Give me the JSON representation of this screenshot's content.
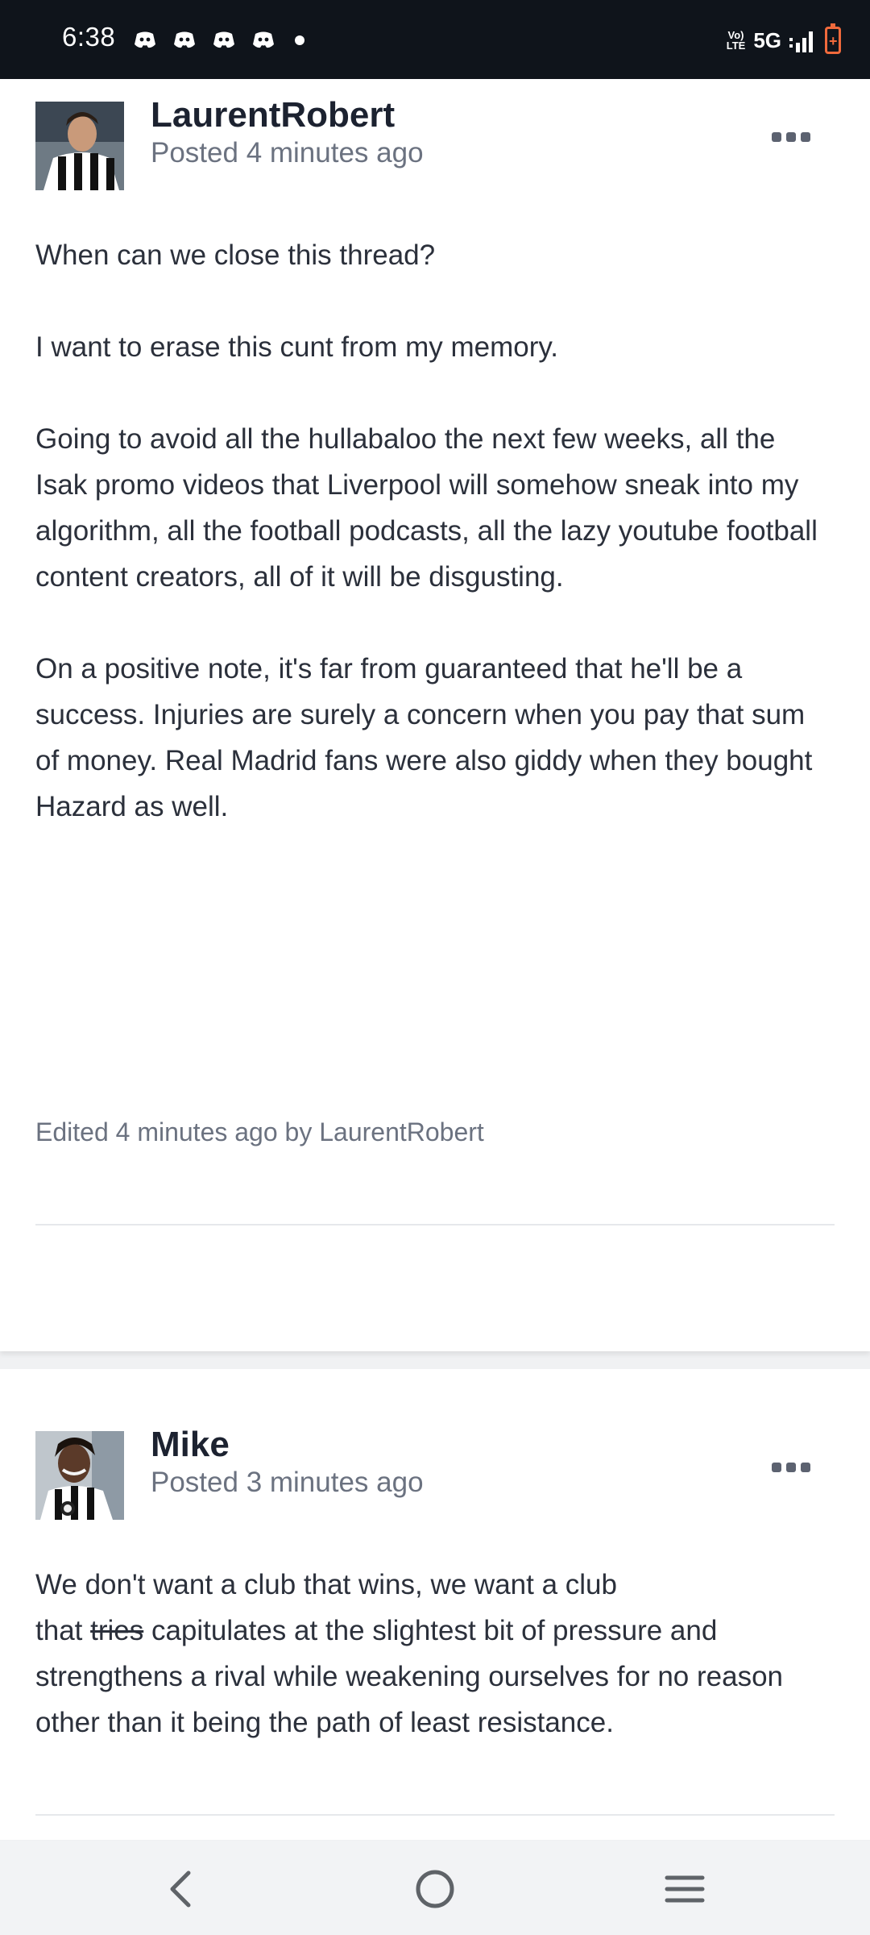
{
  "status_bar": {
    "time": "6:38",
    "notification_icons": [
      "discord-icon",
      "discord-icon",
      "discord-icon",
      "discord-icon"
    ],
    "volte_top": "Vo)",
    "volte_bottom": "LTE",
    "network": "5G",
    "battery_color": "#f06a3c"
  },
  "posts": [
    {
      "author": "LaurentRobert",
      "posted": "Posted 4 minutes ago",
      "paragraphs": [
        "When can we close this thread?",
        "I want to erase this cunt from my memory.",
        "Going to avoid all the hullabaloo the next few weeks, all the Isak promo videos that Liverpool will somehow sneak into my algorithm, all the football podcasts, all the lazy youtube football content creators, all of it will be disgusting.",
        "On a positive note, it's far from guaranteed that he'll be a success. Injuries are surely a concern when you pay that sum of money. Real Madrid fans were also giddy when they bought Hazard as well."
      ],
      "edited": "Edited 4 minutes ago by LaurentRobert"
    },
    {
      "author": "Mike",
      "posted": "Posted 3 minutes ago",
      "line1": "We don't want a club that wins, we want a club",
      "line2_start": "that ",
      "struck_word": "tries",
      "line2_rest": " capitulates at the slightest bit of pressure and strengthens a rival while weakening ourselves for no reason other than it being the path of least resistance."
    }
  ],
  "nav": {
    "back_icon": "back-icon",
    "home_icon": "home-icon",
    "recents_icon": "recents-icon"
  }
}
